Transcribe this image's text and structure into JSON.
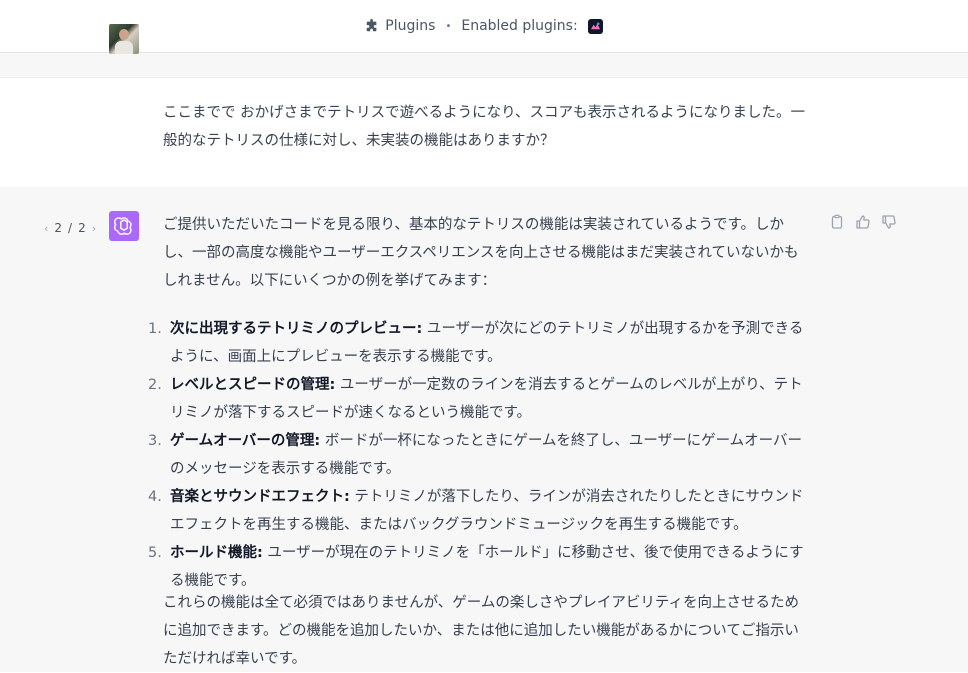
{
  "topbar": {
    "plugins_label": "Plugins",
    "separator": "•",
    "enabled_label": "Enabled plugins:",
    "plugin_icon": "puzzle-icon"
  },
  "user": {
    "message": "ここまでで おかげさまでテトリスで遊べるようになり、スコアも表示されるようになりました。一般的なテトリスの仕様に対し、未実装の機能はありますか？"
  },
  "assistant": {
    "pager": {
      "current": "2",
      "separator": "/",
      "total": "2"
    },
    "intro": "ご提供いただいたコードを見る限り、基本的なテトリスの機能は実装されているようです。しかし、一部の高度な機能やユーザーエクスペリエンスを向上させる機能はまだ実装されていないかもしれません。以下にいくつかの例を挙げてみます：",
    "features": [
      {
        "num": "1.",
        "title": "次に出現するテトリミノのプレビュー:",
        "text": " ユーザーが次にどのテトリミノが出現するかを予測できるように、画面上にプレビューを表示する機能です。"
      },
      {
        "num": "2.",
        "title": "レベルとスピードの管理:",
        "text": " ユーザーが一定数のラインを消去するとゲームのレベルが上がり、テトリミノが落下するスピードが速くなるという機能です。"
      },
      {
        "num": "3.",
        "title": "ゲームオーバーの管理:",
        "text": " ボードが一杯になったときにゲームを終了し、ユーザーにゲームオーバーのメッセージを表示する機能です。"
      },
      {
        "num": "4.",
        "title": "音楽とサウンドエフェクト:",
        "text": " テトリミノが落下したり、ラインが消去されたりしたときにサウンドエフェクトを再生する機能、またはバックグラウンドミュージックを再生する機能です。"
      },
      {
        "num": "5.",
        "title": "ホールド機能:",
        "text": " ユーザーが現在のテトリミノを「ホールド」に移動させ、後で使用できるようにする機能です。"
      }
    ],
    "outro": "これらの機能は全て必須ではありませんが、ゲームの楽しさやプレイアビリティを向上させるために追加できます。どの機能を追加したいか、または他に追加したい機能があるかについてご指示いただければ幸いです。"
  },
  "colors": {
    "assistant_logo_bg": "#ab68ff",
    "assistant_bg": "#f7f7f8"
  }
}
